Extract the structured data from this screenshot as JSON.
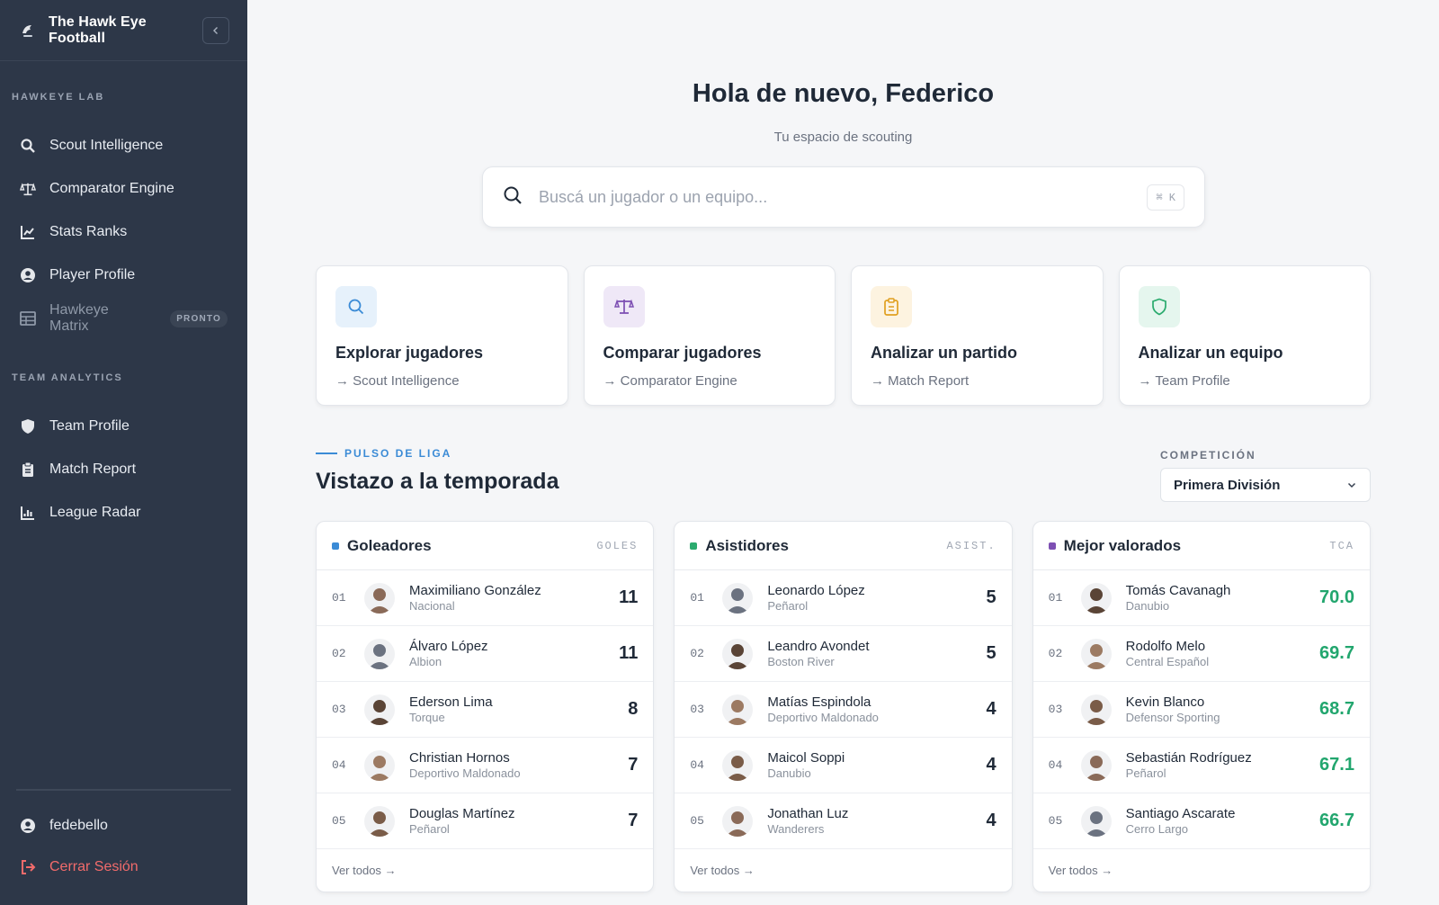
{
  "app": {
    "title": "The Hawk Eye Football"
  },
  "sidebar": {
    "sections": [
      {
        "label": "HAWKEYE LAB",
        "items": [
          {
            "label": "Scout Intelligence",
            "icon": "search-icon"
          },
          {
            "label": "Comparator Engine",
            "icon": "scale-icon"
          },
          {
            "label": "Stats Ranks",
            "icon": "line-chart-icon"
          },
          {
            "label": "Player Profile",
            "icon": "user-circle-icon"
          },
          {
            "label": "Hawkeye Matrix",
            "icon": "table-icon",
            "badge": "PRONTO"
          }
        ]
      },
      {
        "label": "TEAM ANALYTICS",
        "items": [
          {
            "label": "Team Profile",
            "icon": "shield-icon"
          },
          {
            "label": "Match Report",
            "icon": "clipboard-icon"
          },
          {
            "label": "League Radar",
            "icon": "bar-chart-icon"
          }
        ]
      }
    ],
    "user": {
      "name": "fedebello",
      "logout": "Cerrar Sesión"
    }
  },
  "main": {
    "greeting": "Hola de nuevo, Federico",
    "subtitle": "Tu espacio de scouting",
    "search": {
      "placeholder": "Buscá un jugador o un equipo...",
      "shortcut": "⌘ K"
    },
    "cards": [
      {
        "title": "Explorar jugadores",
        "sub": "Scout Intelligence",
        "icon": "search-icon",
        "color": "#3b8bd6",
        "bg": "#e6f1fb"
      },
      {
        "title": "Comparar jugadores",
        "sub": "Comparator Engine",
        "icon": "scale-icon",
        "color": "#7d4fb3",
        "bg": "#efe8f7"
      },
      {
        "title": "Analizar un partido",
        "sub": "Match Report",
        "icon": "clipboard-icon",
        "color": "#e0a020",
        "bg": "#fdf3e0"
      },
      {
        "title": "Analizar un equipo",
        "sub": "Team Profile",
        "icon": "shield-icon",
        "color": "#2bab6e",
        "bg": "#e5f6ee"
      }
    ],
    "pulse_label": "PULSO DE LIGA",
    "season_title": "Vistazo a la temporada",
    "competition": {
      "label": "COMPETICIÓN",
      "value": "Primera División"
    },
    "see_all": "Ver todos",
    "lists": [
      {
        "title": "Goleadores",
        "metric": "GOLES",
        "dot": "#3b8bd6",
        "green": false,
        "rows": [
          {
            "rank": "01",
            "name": "Maximiliano González",
            "team": "Nacional",
            "value": "11"
          },
          {
            "rank": "02",
            "name": "Álvaro López",
            "team": "Albion",
            "value": "11"
          },
          {
            "rank": "03",
            "name": "Ederson Lima",
            "team": "Torque",
            "value": "8"
          },
          {
            "rank": "04",
            "name": "Christian Hornos",
            "team": "Deportivo Maldonado",
            "value": "7"
          },
          {
            "rank": "05",
            "name": "Douglas Martínez",
            "team": "Peñarol",
            "value": "7"
          }
        ]
      },
      {
        "title": "Asistidores",
        "metric": "ASIST.",
        "dot": "#2bab6e",
        "green": false,
        "rows": [
          {
            "rank": "01",
            "name": "Leonardo López",
            "team": "Peñarol",
            "value": "5"
          },
          {
            "rank": "02",
            "name": "Leandro Avondet",
            "team": "Boston River",
            "value": "5"
          },
          {
            "rank": "03",
            "name": "Matías Espindola",
            "team": "Deportivo Maldonado",
            "value": "4"
          },
          {
            "rank": "04",
            "name": "Maicol Soppi",
            "team": "Danubio",
            "value": "4"
          },
          {
            "rank": "05",
            "name": "Jonathan Luz",
            "team": "Wanderers",
            "value": "4"
          }
        ]
      },
      {
        "title": "Mejor valorados",
        "metric": "TCA",
        "dot": "#7d4fb3",
        "green": true,
        "rows": [
          {
            "rank": "01",
            "name": "Tomás Cavanagh",
            "team": "Danubio",
            "value": "70.0"
          },
          {
            "rank": "02",
            "name": "Rodolfo Melo",
            "team": "Central Español",
            "value": "69.7"
          },
          {
            "rank": "03",
            "name": "Kevin Blanco",
            "team": "Defensor Sporting",
            "value": "68.7"
          },
          {
            "rank": "04",
            "name": "Sebastián Rodríguez",
            "team": "Peñarol",
            "value": "67.1"
          },
          {
            "rank": "05",
            "name": "Santiago Ascarate",
            "team": "Cerro Largo",
            "value": "66.7"
          }
        ]
      }
    ]
  }
}
